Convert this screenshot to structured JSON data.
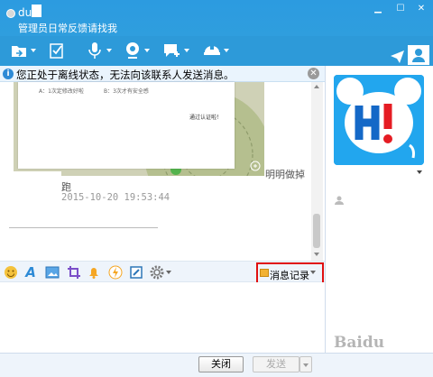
{
  "titlebar": {
    "name": "du",
    "signature": "管理员日常反馈请找我"
  },
  "notice": {
    "text": "您正处于离线状态，无法向该联系人发送消息。"
  },
  "chat": {
    "image_card": {
      "option_a": "A：1次定修改好啦",
      "option_b": "B：3次才有安全感",
      "pass_text": "通过认证啦！"
    },
    "message_right": "明明做掉",
    "message_user": "跑",
    "message_time": "2015-10-20 19:53:44"
  },
  "input_toolbar": {
    "history_label": "消息记录"
  },
  "bottom": {
    "close_label": "关闭",
    "send_label": "发送"
  },
  "watermark": "Baidu"
}
